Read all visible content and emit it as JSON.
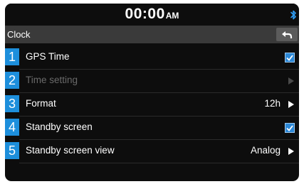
{
  "status_bar": {
    "time": "00:00",
    "ampm": "AM",
    "bluetooth_icon": "bluetooth-icon"
  },
  "header": {
    "title": "Clock",
    "back_icon": "back-arrow-icon"
  },
  "rows": [
    {
      "number": "1",
      "label": "GPS Time",
      "control": "checkbox",
      "checked": true,
      "enabled": true
    },
    {
      "number": "2",
      "label": "Time setting",
      "control": "arrow",
      "enabled": false
    },
    {
      "number": "3",
      "label": "Format",
      "value": "12h",
      "control": "arrow",
      "enabled": true
    },
    {
      "number": "4",
      "label": "Standby screen",
      "control": "checkbox",
      "checked": true,
      "enabled": true
    },
    {
      "number": "5",
      "label": "Standby screen view",
      "value": "Analog",
      "control": "arrow",
      "enabled": true
    }
  ],
  "colors": {
    "accent": "#1d8fdc",
    "checkbox": "#2b87d6",
    "background": "#0d0d0d",
    "header": "#3a3a3a"
  }
}
